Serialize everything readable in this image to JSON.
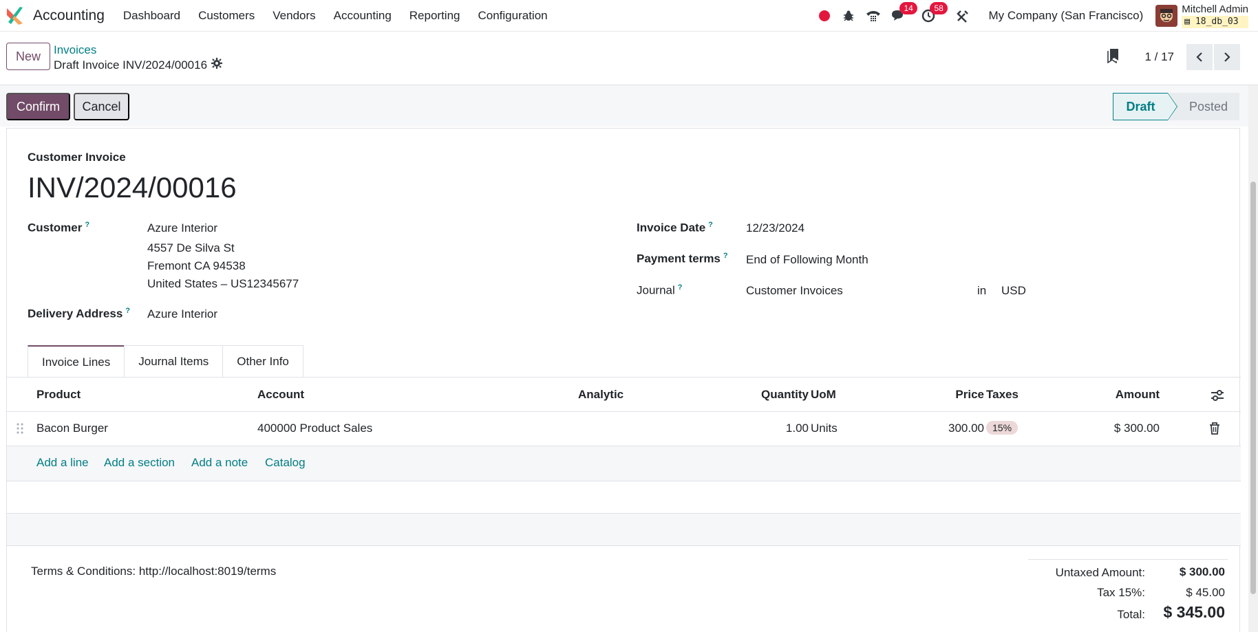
{
  "navbar": {
    "app_name": "Accounting",
    "menu": [
      "Dashboard",
      "Customers",
      "Vendors",
      "Accounting",
      "Reporting",
      "Configuration"
    ],
    "chat_count": "14",
    "activity_count": "58",
    "company": "My Company (San Francisco)",
    "user_name": "Mitchell Admin",
    "db_name": "18_db_03"
  },
  "control": {
    "new_label": "New",
    "breadcrumb_parent": "Invoices",
    "breadcrumb_current": "Draft Invoice INV/2024/00016",
    "pager_value": "1 / 17"
  },
  "actions": {
    "confirm_label": "Confirm",
    "cancel_label": "Cancel",
    "status_draft": "Draft",
    "status_posted": "Posted"
  },
  "form": {
    "doc_type": "Customer Invoice",
    "doc_name": "INV/2024/00016",
    "customer_label": "Customer",
    "customer_name": "Azure Interior",
    "customer_address": [
      "4557 De Silva St",
      "Fremont CA 94538",
      "United States – US12345677"
    ],
    "delivery_label": "Delivery Address",
    "delivery_value": "Azure Interior",
    "invoice_date_label": "Invoice Date",
    "invoice_date_value": "12/23/2024",
    "payment_terms_label": "Payment terms",
    "payment_terms_value": "End of Following Month",
    "journal_label": "Journal",
    "journal_value": "Customer Invoices",
    "journal_in": "in",
    "currency": "USD",
    "help_mark": "?"
  },
  "tabs": [
    "Invoice Lines",
    "Journal Items",
    "Other Info"
  ],
  "table": {
    "headers": [
      "Product",
      "Account",
      "Analytic",
      "Quantity",
      "UoM",
      "Price",
      "Taxes",
      "Amount"
    ],
    "rows": [
      {
        "product": "Bacon Burger",
        "account": "400000 Product Sales",
        "analytic": "",
        "quantity": "1.00",
        "uom": "Units",
        "price": "300.00",
        "tax": "15%",
        "amount": "$ 300.00"
      }
    ],
    "add_links": [
      "Add a line",
      "Add a section",
      "Add a note",
      "Catalog"
    ]
  },
  "footer": {
    "terms": "Terms & Conditions: http://localhost:8019/terms",
    "untaxed_label": "Untaxed Amount:",
    "untaxed_value": "$ 300.00",
    "tax_label": "Tax 15%:",
    "tax_value": "$ 45.00",
    "total_label": "Total:",
    "total_value": "$ 345.00"
  },
  "colors": {
    "primary": "#714b67",
    "link": "#017e84",
    "badge": "#e3173e"
  }
}
